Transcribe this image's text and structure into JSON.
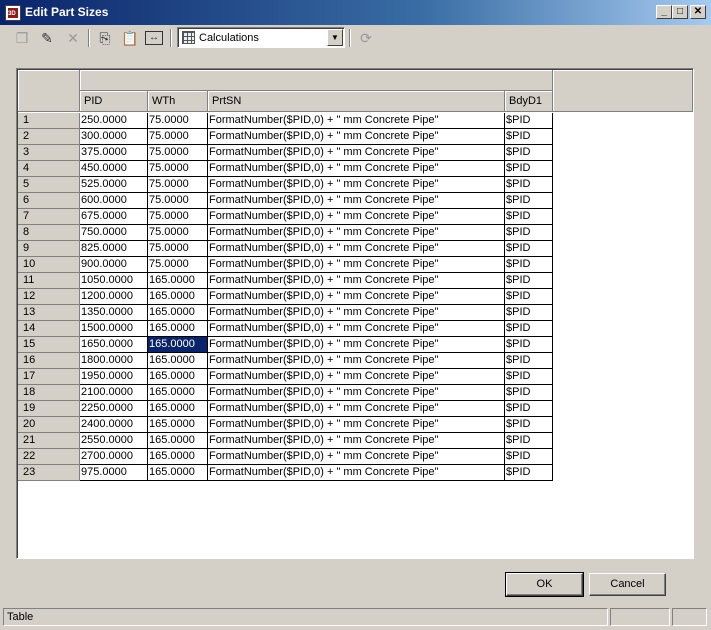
{
  "window": {
    "title": "Edit Part Sizes",
    "app_icon": "3D",
    "controls": {
      "minimize": "_",
      "maximize": "□",
      "close": "✕"
    }
  },
  "toolbar": {
    "icons": [
      "new-row-icon",
      "edit-row-icon",
      "delete-icon",
      "copy-icon",
      "paste-icon",
      "column-width-icon",
      "refresh-icon"
    ],
    "view_combo": {
      "value": "Calculations",
      "icon": "calculator-icon"
    }
  },
  "grid": {
    "group_header": "",
    "columns": [
      "PID",
      "WTh",
      "PrtSN",
      "BdyD1"
    ],
    "selected": {
      "row": 14,
      "col": 1
    },
    "rows": [
      {
        "n": "1",
        "pid": "250.0000",
        "wth": "75.0000",
        "prtsn": "FormatNumber($PID,0) + \" mm Concrete Pipe\"",
        "bdyd1": "$PID"
      },
      {
        "n": "2",
        "pid": "300.0000",
        "wth": "75.0000",
        "prtsn": "FormatNumber($PID,0) + \" mm Concrete Pipe\"",
        "bdyd1": "$PID"
      },
      {
        "n": "3",
        "pid": "375.0000",
        "wth": "75.0000",
        "prtsn": "FormatNumber($PID,0) + \" mm Concrete Pipe\"",
        "bdyd1": "$PID"
      },
      {
        "n": "4",
        "pid": "450.0000",
        "wth": "75.0000",
        "prtsn": "FormatNumber($PID,0) + \" mm Concrete Pipe\"",
        "bdyd1": "$PID"
      },
      {
        "n": "5",
        "pid": "525.0000",
        "wth": "75.0000",
        "prtsn": "FormatNumber($PID,0) + \" mm Concrete Pipe\"",
        "bdyd1": "$PID"
      },
      {
        "n": "6",
        "pid": "600.0000",
        "wth": "75.0000",
        "prtsn": "FormatNumber($PID,0) + \" mm Concrete Pipe\"",
        "bdyd1": "$PID"
      },
      {
        "n": "7",
        "pid": "675.0000",
        "wth": "75.0000",
        "prtsn": "FormatNumber($PID,0) + \" mm Concrete Pipe\"",
        "bdyd1": "$PID"
      },
      {
        "n": "8",
        "pid": "750.0000",
        "wth": "75.0000",
        "prtsn": "FormatNumber($PID,0) + \" mm Concrete Pipe\"",
        "bdyd1": "$PID"
      },
      {
        "n": "9",
        "pid": "825.0000",
        "wth": "75.0000",
        "prtsn": "FormatNumber($PID,0) + \" mm Concrete Pipe\"",
        "bdyd1": "$PID"
      },
      {
        "n": "10",
        "pid": "900.0000",
        "wth": "75.0000",
        "prtsn": "FormatNumber($PID,0) + \" mm Concrete Pipe\"",
        "bdyd1": "$PID"
      },
      {
        "n": "11",
        "pid": "1050.0000",
        "wth": "165.0000",
        "prtsn": "FormatNumber($PID,0) + \" mm Concrete Pipe\"",
        "bdyd1": "$PID"
      },
      {
        "n": "12",
        "pid": "1200.0000",
        "wth": "165.0000",
        "prtsn": "FormatNumber($PID,0) + \" mm Concrete Pipe\"",
        "bdyd1": "$PID"
      },
      {
        "n": "13",
        "pid": "1350.0000",
        "wth": "165.0000",
        "prtsn": "FormatNumber($PID,0) + \" mm Concrete Pipe\"",
        "bdyd1": "$PID"
      },
      {
        "n": "14",
        "pid": "1500.0000",
        "wth": "165.0000",
        "prtsn": "FormatNumber($PID,0) + \" mm Concrete Pipe\"",
        "bdyd1": "$PID"
      },
      {
        "n": "15",
        "pid": "1650.0000",
        "wth": "165.0000",
        "prtsn": "FormatNumber($PID,0) + \" mm Concrete Pipe\"",
        "bdyd1": "$PID"
      },
      {
        "n": "16",
        "pid": "1800.0000",
        "wth": "165.0000",
        "prtsn": "FormatNumber($PID,0) + \" mm Concrete Pipe\"",
        "bdyd1": "$PID"
      },
      {
        "n": "17",
        "pid": "1950.0000",
        "wth": "165.0000",
        "prtsn": "FormatNumber($PID,0) + \" mm Concrete Pipe\"",
        "bdyd1": "$PID"
      },
      {
        "n": "18",
        "pid": "2100.0000",
        "wth": "165.0000",
        "prtsn": "FormatNumber($PID,0) + \" mm Concrete Pipe\"",
        "bdyd1": "$PID"
      },
      {
        "n": "19",
        "pid": "2250.0000",
        "wth": "165.0000",
        "prtsn": "FormatNumber($PID,0) + \" mm Concrete Pipe\"",
        "bdyd1": "$PID"
      },
      {
        "n": "20",
        "pid": "2400.0000",
        "wth": "165.0000",
        "prtsn": "FormatNumber($PID,0) + \" mm Concrete Pipe\"",
        "bdyd1": "$PID"
      },
      {
        "n": "21",
        "pid": "2550.0000",
        "wth": "165.0000",
        "prtsn": "FormatNumber($PID,0) + \" mm Concrete Pipe\"",
        "bdyd1": "$PID"
      },
      {
        "n": "22",
        "pid": "2700.0000",
        "wth": "165.0000",
        "prtsn": "FormatNumber($PID,0) + \" mm Concrete Pipe\"",
        "bdyd1": "$PID"
      },
      {
        "n": "23",
        "pid": "975.0000",
        "wth": "165.0000",
        "prtsn": "FormatNumber($PID,0) + \" mm Concrete Pipe\"",
        "bdyd1": "$PID"
      }
    ]
  },
  "buttons": {
    "ok": "OK",
    "cancel": "Cancel"
  },
  "statusbar": {
    "text": "Table"
  },
  "colors": {
    "selection": "#0a246a",
    "face": "#d4d0c8"
  }
}
